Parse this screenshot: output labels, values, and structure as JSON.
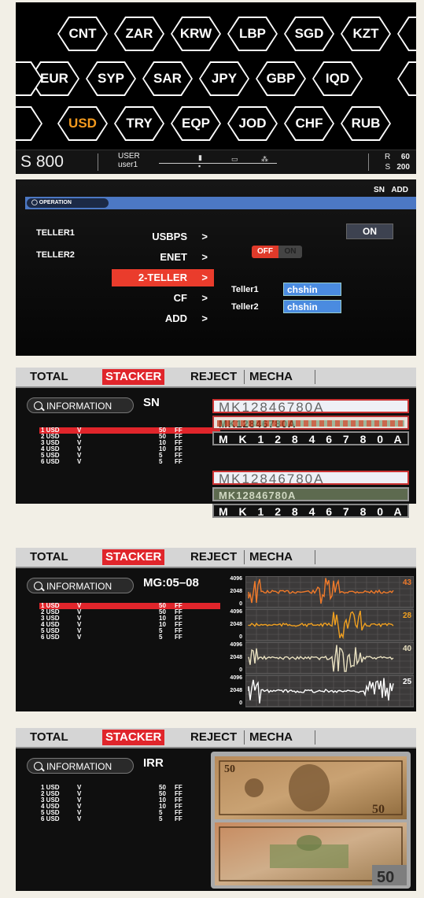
{
  "currency_screen": {
    "currencies": [
      "CNT",
      "ZAR",
      "KRW",
      "LBP",
      "SGD",
      "KZT",
      "EUR",
      "SYP",
      "SAR",
      "JPY",
      "GBP",
      "IQD",
      "USD",
      "TRY",
      "EQP",
      "JOD",
      "CHF",
      "RUB"
    ],
    "selected": "USD",
    "status": {
      "mode": "S 800",
      "user_label": "USER",
      "user_name": "user1",
      "r_label": "R",
      "r_value": "60",
      "s_label": "S",
      "s_value": "200"
    }
  },
  "operation_screen": {
    "top_right": "SN  ADD",
    "section_tab": "OPERATION",
    "teller_left": [
      "TELLER1",
      "TELLER2"
    ],
    "menu": [
      {
        "label": "USBPS",
        "arrow": ">"
      },
      {
        "label": "ENET",
        "arrow": ">"
      },
      {
        "label": "2-TELLER",
        "arrow": ">",
        "active": true
      },
      {
        "label": "CF",
        "arrow": ">"
      },
      {
        "label": "ADD",
        "arrow": ">"
      }
    ],
    "toggle_off": "OFF",
    "toggle_on": "ON",
    "on_button": "ON",
    "tellers": [
      {
        "label": "Teller1",
        "value": "chshin"
      },
      {
        "label": "Teller2",
        "value": "chshin"
      }
    ]
  },
  "tabs": [
    "TOTAL",
    "STACKER",
    "REJECT",
    "MECHA"
  ],
  "selected_tab": "STACKER",
  "info_button": "INFORMATION",
  "rows": [
    {
      "count": "1 USD",
      "mark": "V",
      "value": "50",
      "flag": "FF"
    },
    {
      "count": "2 USD",
      "mark": "V",
      "value": "50",
      "flag": "FF"
    },
    {
      "count": "3 USD",
      "mark": "V",
      "value": "10",
      "flag": "FF"
    },
    {
      "count": "4 USD",
      "mark": "V",
      "value": "10",
      "flag": "FF"
    },
    {
      "count": "5 USD",
      "mark": "V",
      "value": "5",
      "flag": "FF"
    },
    {
      "count": "6 USD",
      "mark": "V",
      "value": "5",
      "flag": "FF"
    }
  ],
  "sn_screen": {
    "title": "SN",
    "serial_top": [
      "MK12846780A",
      "MK12846780A",
      "M K 1 2 8 4 6 7 8 0 A"
    ],
    "serial_bottom": [
      "MK12846780A",
      "MK12846780A",
      "M K 1 2 8 4 6 7 8 0 A"
    ]
  },
  "mg_screen": {
    "title": "MG:05–08",
    "axis_ticks": [
      "4096",
      "2048",
      "0"
    ],
    "channels": [
      {
        "value": "43",
        "color": "#f07a2a"
      },
      {
        "value": "28",
        "color": "#f0a020"
      },
      {
        "value": "40",
        "color": "#e8e0c0"
      },
      {
        "value": "25",
        "color": "#ffffff"
      }
    ]
  },
  "irr_screen": {
    "title": "IRR",
    "note_denomination": "50"
  },
  "colors": {
    "accent_red": "#e0252b",
    "selected_currency": "#f39a1e",
    "teller_blue": "#4a8be0"
  }
}
